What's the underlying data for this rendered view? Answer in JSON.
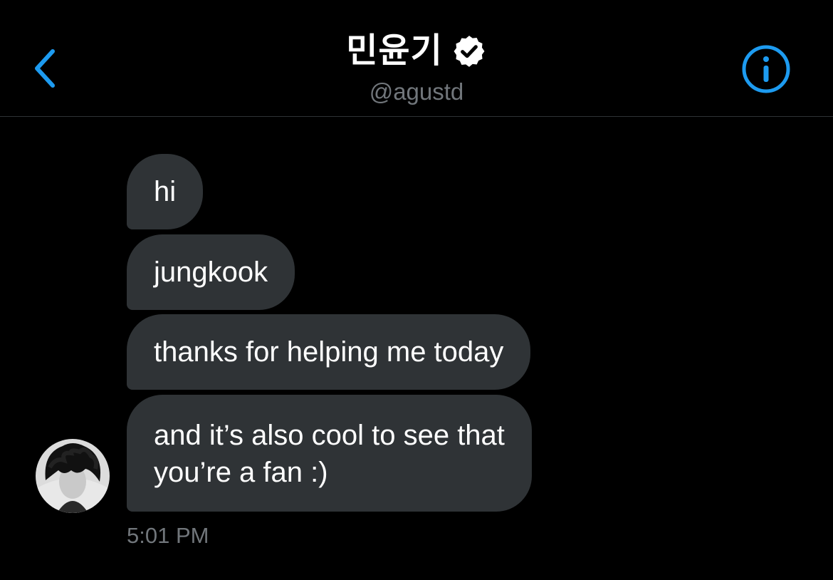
{
  "header": {
    "name": "민윤기",
    "handle": "@agustd",
    "verified": true,
    "icons": {
      "back": "chevron-left-icon",
      "info": "info-circle-icon",
      "verified": "verified-badge-icon"
    },
    "accent_color": "#1d9bf0"
  },
  "messages": [
    {
      "text": "hi"
    },
    {
      "text": "jungkook"
    },
    {
      "text": "thanks for helping me today"
    },
    {
      "text": "and it’s also cool to see that\nyou’re a fan :)"
    }
  ],
  "timestamp": "5:01 PM",
  "colors": {
    "background": "#000000",
    "bubble": "#2f3336",
    "secondary_text": "#71767b",
    "divider": "#2f3336"
  }
}
